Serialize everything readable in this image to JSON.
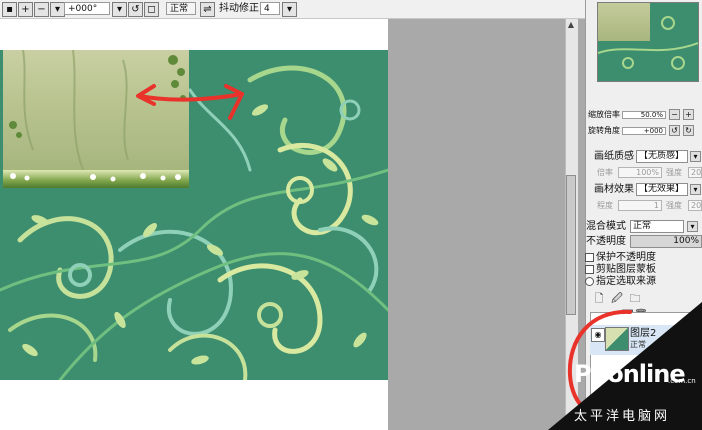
{
  "toolbar": {
    "angle_value": "+000°",
    "blend_mode": "正常",
    "stabilizer_label": "抖动修正",
    "stabilizer_value": "4"
  },
  "navigator": {
    "zoom_label": "缩放倍率",
    "zoom_value": "50.0%",
    "rotate_label": "旋转角度",
    "rotate_value": "+000"
  },
  "paper": {
    "texture_label": "画纸质感",
    "texture_value": "【无质感】",
    "texture_scale_label": "倍率",
    "texture_scale_value": "100%",
    "texture_strength_label": "强度",
    "texture_strength_value": "20",
    "effect_label": "画材效果",
    "effect_value": "【无效果】",
    "effect_degree_label": "程度",
    "effect_degree_value": "1",
    "effect_strength_label": "强度",
    "effect_strength_value": "20"
  },
  "layer_props": {
    "blend_label": "混合模式",
    "blend_value": "正常",
    "opacity_label": "不透明度",
    "opacity_value": "100%",
    "protect_alpha": "保护不透明度",
    "clipping": "剪贴图层蒙板",
    "selection_source": "指定选取来源"
  },
  "layers": [
    {
      "name": "图层2",
      "mode": "正常"
    }
  ],
  "watermark": {
    "brand": "PConline",
    "domain_suffix": ".com.cn",
    "chinese": "太平洋电脑网"
  },
  "colors": {
    "pattern_green": "#3d8d6f",
    "annotation_red": "#e8322a",
    "panel_bg": "#efefef"
  }
}
